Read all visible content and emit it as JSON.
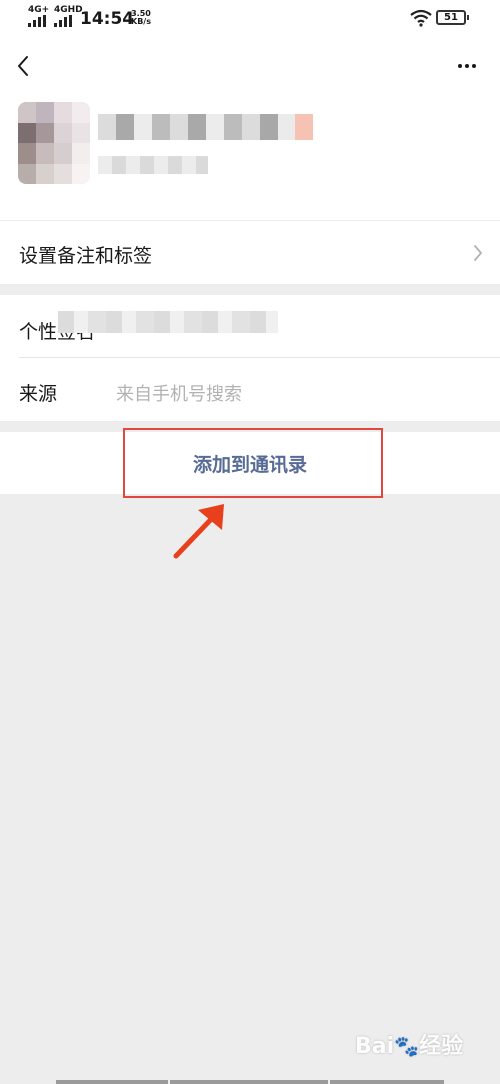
{
  "status_bar": {
    "network_1": "4G+",
    "network_2": "4GHD",
    "time": "14:54",
    "speed_value": "3.50",
    "speed_unit": "KB/s",
    "battery": "51"
  },
  "header": {
    "back_icon": "chevron-left-icon",
    "more_icon": "more-dots-icon"
  },
  "rows": {
    "remark": {
      "label": "设置备注和标签",
      "icon": "chevron-right-icon"
    },
    "signature": {
      "label": "个性签名"
    },
    "source": {
      "label": "来源",
      "value": "来自手机号搜索"
    }
  },
  "actions": {
    "add_contact": "添加到通讯录"
  },
  "annotation": {
    "box_color": "#e0473e",
    "arrow_color": "#e8401c"
  },
  "watermark": {
    "text": "Bai",
    "text2": "经验"
  },
  "colors": {
    "link": "#576b95",
    "background": "#ededed"
  }
}
